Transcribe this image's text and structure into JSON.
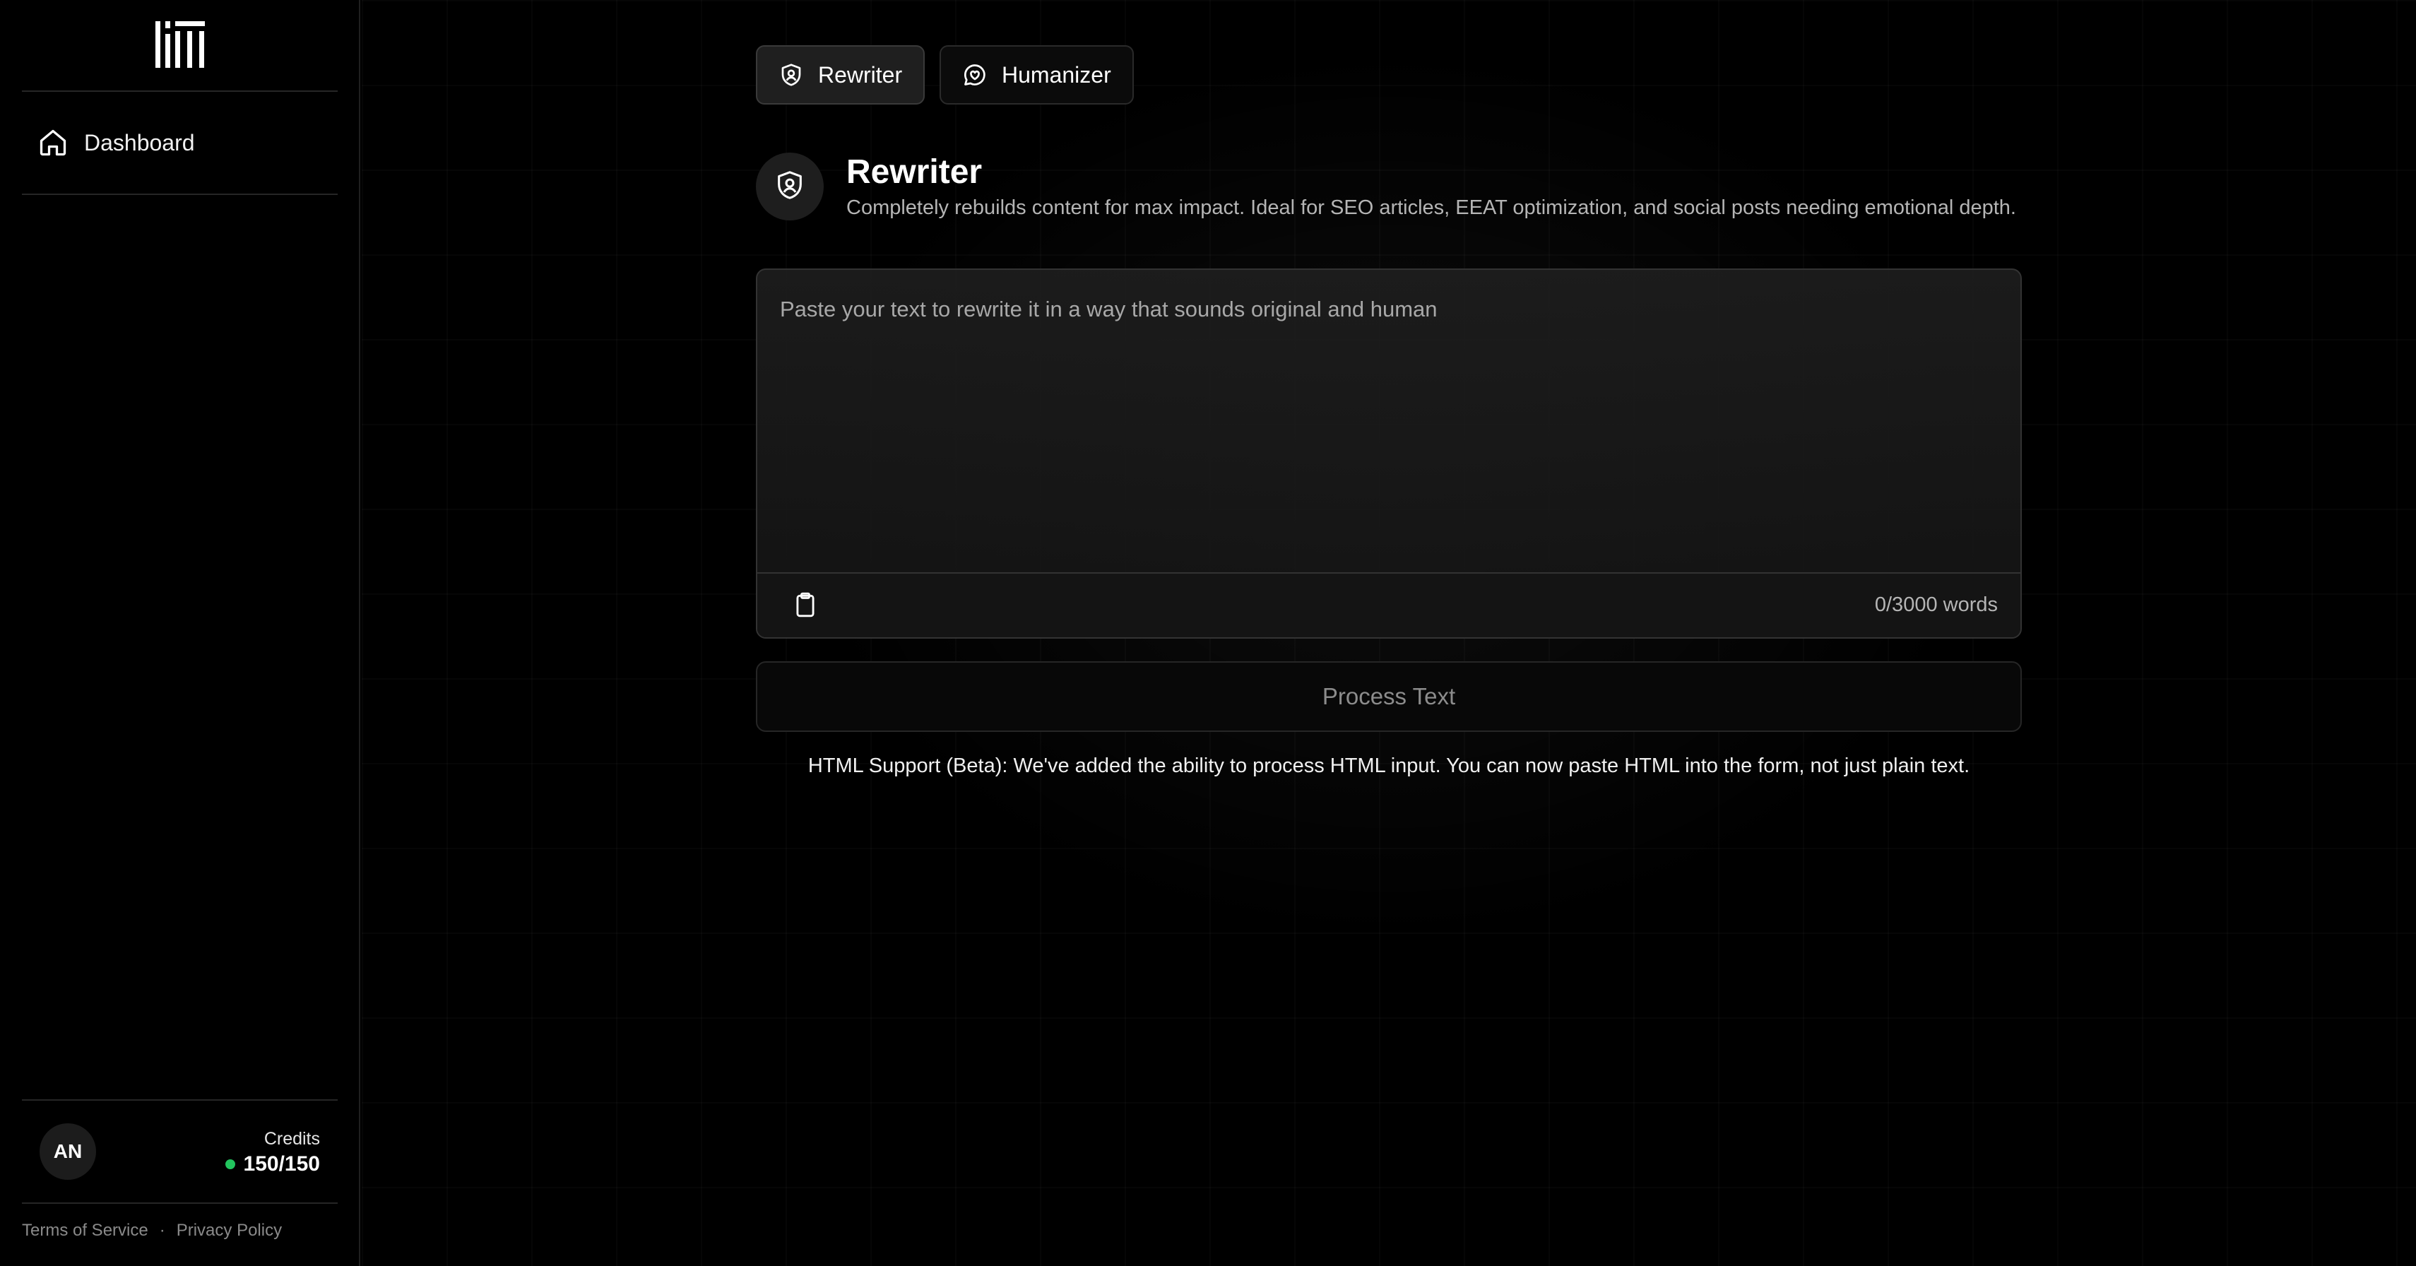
{
  "sidebar": {
    "logo": "app-logo",
    "nav": [
      {
        "label": "Dashboard",
        "icon": "home-icon"
      }
    ],
    "user": {
      "initials": "AN",
      "credits_label": "Credits",
      "credits_value": "150/150",
      "status_color": "#22c55e"
    },
    "footer": {
      "terms": "Terms of Service",
      "separator": "·",
      "privacy": "Privacy Policy"
    }
  },
  "tabs": [
    {
      "label": "Rewriter",
      "icon": "shield-user-icon",
      "active": true
    },
    {
      "label": "Humanizer",
      "icon": "chat-heart-icon",
      "active": false
    }
  ],
  "tool": {
    "title": "Rewriter",
    "description": "Completely rebuilds content for max impact. Ideal for SEO articles, EEAT optimization, and social posts needing emotional depth."
  },
  "editor": {
    "value": "",
    "placeholder": "Paste your text to rewrite it in a way that sounds original and human",
    "word_count": "0/3000 words"
  },
  "process_button": "Process Text",
  "notice": "HTML Support (Beta): We've added the ability to process HTML input. You can now paste HTML into the form, not just plain text."
}
